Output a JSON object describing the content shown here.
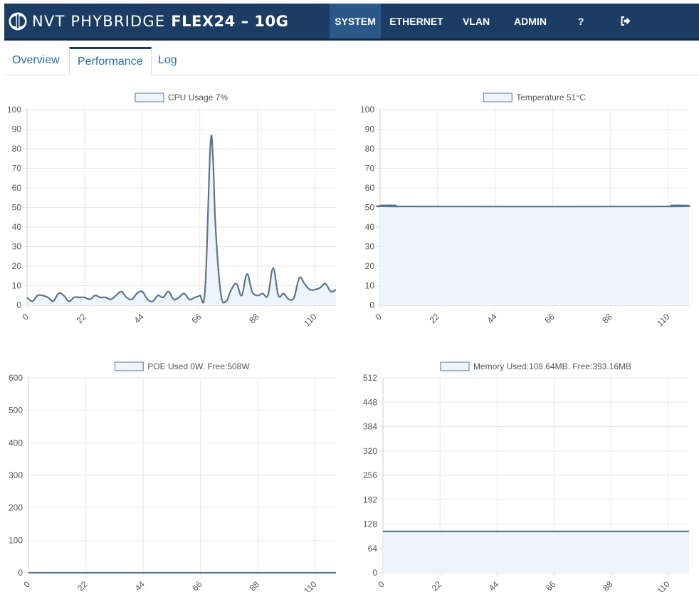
{
  "brand": {
    "name": "NVT PHYBRIDGE",
    "model": "FLEX24 – 10G"
  },
  "nav": [
    {
      "label": "SYSTEM",
      "name": "nav-system",
      "active": true
    },
    {
      "label": "ETHERNET",
      "name": "nav-ethernet"
    },
    {
      "label": "VLAN",
      "name": "nav-vlan"
    },
    {
      "label": "ADMIN",
      "name": "nav-admin"
    },
    {
      "label": "?",
      "name": "nav-help"
    },
    {
      "label": "",
      "name": "nav-logout",
      "icon": "logout-icon"
    }
  ],
  "tabs": [
    {
      "label": "Overview"
    },
    {
      "label": "Performance",
      "active": true
    },
    {
      "label": "Log"
    }
  ],
  "colors": {
    "brand": "#1c3d63",
    "nav_active": "#2a5889",
    "line": "#5a7590",
    "fill": "#eef4fc",
    "link": "#2a6fa8"
  },
  "chart_data": [
    {
      "type": "area",
      "legend": "CPU Usage 7%",
      "ylim": [
        0,
        100
      ],
      "yticks": [
        0,
        10,
        20,
        30,
        40,
        50,
        60,
        70,
        80,
        90,
        100
      ],
      "xlim": [
        0,
        118
      ],
      "xticks": [
        0,
        22,
        44,
        66,
        88,
        110
      ],
      "series": [
        {
          "x": [
            0,
            2,
            4,
            6,
            8,
            10,
            12,
            14,
            16,
            18,
            20,
            22,
            24,
            26,
            28,
            30,
            32,
            34,
            36,
            38,
            40,
            42,
            44,
            46,
            48,
            50,
            52,
            54,
            56,
            58,
            60,
            62,
            64,
            66,
            68,
            70,
            71,
            72,
            74,
            76,
            78,
            80,
            82,
            84,
            86,
            88,
            90,
            92,
            94,
            96,
            98,
            100,
            102,
            104,
            106,
            108,
            110,
            112,
            114,
            116,
            118
          ],
          "y": [
            4,
            2,
            5,
            5,
            4,
            2,
            6,
            5,
            2,
            4,
            4,
            4,
            3,
            5,
            4,
            4,
            3,
            5,
            7,
            4,
            3,
            6,
            7,
            3,
            2,
            5,
            4,
            7,
            3,
            4,
            6,
            3,
            4,
            5,
            8,
            81,
            76,
            40,
            6,
            2,
            8,
            11,
            5,
            16,
            7,
            5,
            6,
            5,
            19,
            5,
            6,
            3,
            4,
            14,
            11,
            8,
            8,
            9,
            11,
            7,
            8
          ]
        }
      ]
    },
    {
      "type": "area",
      "legend": "Temperature 51°C",
      "ylim": [
        0,
        100
      ],
      "yticks": [
        0,
        10,
        20,
        30,
        40,
        50,
        60,
        70,
        80,
        90,
        100
      ],
      "xlim": [
        0,
        118
      ],
      "xticks": [
        0,
        22,
        44,
        66,
        88,
        110
      ],
      "series": [
        {
          "x": [
            0,
            6,
            7,
            110,
            111,
            118
          ],
          "y": [
            51,
            51,
            50.5,
            50.5,
            51,
            51
          ]
        }
      ]
    },
    {
      "type": "area",
      "legend": "POE Used 0W. Free:508W",
      "ylim": [
        0,
        600
      ],
      "yticks": [
        0,
        100,
        200,
        300,
        400,
        500,
        600
      ],
      "xlim": [
        0,
        118
      ],
      "xticks": [
        0,
        22,
        44,
        66,
        88,
        110
      ],
      "series": [
        {
          "x": [
            0,
            118
          ],
          "y": [
            0,
            0
          ]
        }
      ]
    },
    {
      "type": "area",
      "legend": "Memory Used:108.64MB. Free:393.16MB",
      "ylim": [
        0,
        512
      ],
      "yticks": [
        0,
        64,
        128,
        192,
        256,
        320,
        384,
        448,
        512
      ],
      "xlim": [
        0,
        118
      ],
      "xticks": [
        0,
        22,
        44,
        66,
        88,
        110
      ],
      "series": [
        {
          "x": [
            0,
            118
          ],
          "y": [
            108.64,
            108.64
          ]
        }
      ]
    }
  ]
}
